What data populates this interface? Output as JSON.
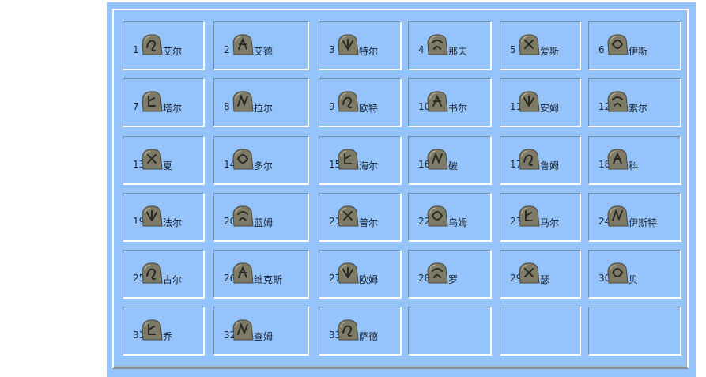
{
  "runes": [
    {
      "num": "1",
      "name": "艾尔"
    },
    {
      "num": "2",
      "name": "艾德"
    },
    {
      "num": "3",
      "name": "特尔"
    },
    {
      "num": "4",
      "name": "那夫"
    },
    {
      "num": "5",
      "name": "爱斯"
    },
    {
      "num": "6",
      "name": "伊斯"
    },
    {
      "num": "7",
      "name": "塔尔"
    },
    {
      "num": "8",
      "name": "拉尔"
    },
    {
      "num": "9",
      "name": "欧特"
    },
    {
      "num": "10",
      "name": "书尔"
    },
    {
      "num": "11",
      "name": "安姆"
    },
    {
      "num": "12",
      "name": "索尔"
    },
    {
      "num": "13",
      "name": "夏"
    },
    {
      "num": "14",
      "name": "多尔"
    },
    {
      "num": "15",
      "name": "海尔"
    },
    {
      "num": "16",
      "name": "破"
    },
    {
      "num": "17",
      "name": "鲁姆"
    },
    {
      "num": "18",
      "name": "科"
    },
    {
      "num": "19",
      "name": "法尔"
    },
    {
      "num": "20",
      "name": "蓝姆"
    },
    {
      "num": "21",
      "name": "普尔"
    },
    {
      "num": "22",
      "name": "乌姆"
    },
    {
      "num": "23",
      "name": "马尔"
    },
    {
      "num": "24",
      "name": "伊斯特"
    },
    {
      "num": "25",
      "name": "古尔"
    },
    {
      "num": "26",
      "name": "维克斯"
    },
    {
      "num": "27",
      "name": "欧姆"
    },
    {
      "num": "28",
      "name": "罗"
    },
    {
      "num": "29",
      "name": "瑟"
    },
    {
      "num": "30",
      "name": "贝"
    },
    {
      "num": "31",
      "name": "乔"
    },
    {
      "num": "32",
      "name": "查姆"
    },
    {
      "num": "33",
      "name": "萨德"
    }
  ],
  "empty_slots": 3,
  "colors": {
    "panel_bg": "#94c4fb",
    "stone": "#7d7a68",
    "glyph": "#2a2a22"
  },
  "icon_name": "rune-stone-icon"
}
